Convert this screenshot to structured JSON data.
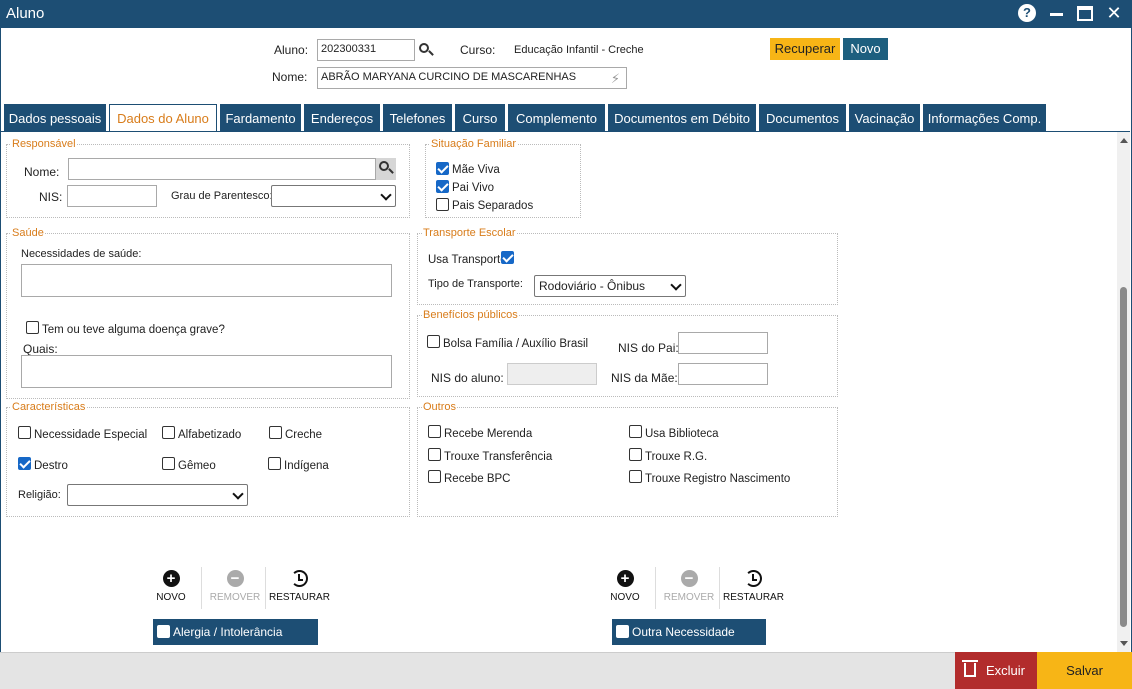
{
  "window": {
    "title": "Aluno"
  },
  "header": {
    "aluno_label": "Aluno:",
    "aluno_value": "202300331",
    "curso_label": "Curso:",
    "curso_value": "Educação Infantil - Creche",
    "nome_label": "Nome:",
    "nome_value": "ABRÃO MARYANA CURCINO DE MASCARENHAS",
    "recuperar_label": "Recuperar",
    "novo_label": "Novo"
  },
  "tabs": [
    {
      "label": "Dados pessoais"
    },
    {
      "label": "Dados do Aluno"
    },
    {
      "label": "Fardamento"
    },
    {
      "label": "Endereços"
    },
    {
      "label": "Telefones"
    },
    {
      "label": "Curso"
    },
    {
      "label": "Complemento"
    },
    {
      "label": "Documentos em Débito"
    },
    {
      "label": "Documentos"
    },
    {
      "label": "Vacinação"
    },
    {
      "label": "Informações Comp."
    }
  ],
  "responsavel": {
    "legend": "Responsável",
    "nome_label": "Nome:",
    "nome_value": "",
    "nis_label": "NIS:",
    "nis_value": "",
    "grau_label": "Grau de Parentesco:",
    "grau_value": ""
  },
  "situacao_familiar": {
    "legend": "Situação Familiar",
    "items": [
      {
        "label": "Mãe Viva",
        "checked": true
      },
      {
        "label": "Pai Vivo",
        "checked": true
      },
      {
        "label": "Pais Separados",
        "checked": false
      }
    ]
  },
  "saude": {
    "legend": "Saúde",
    "necessidades_label": "Necessidades de saúde:",
    "necessidades_value": "",
    "doenca_label": "Tem ou teve alguma doença grave?",
    "doenca_checked": false,
    "quais_label": "Quais:",
    "quais_value": ""
  },
  "transporte": {
    "legend": "Transporte Escolar",
    "usa_label": "Usa Transporte",
    "usa_checked": true,
    "tipo_label": "Tipo de Transporte:",
    "tipo_value": "Rodoviário - Ônibus"
  },
  "beneficios": {
    "legend": "Benefícios públicos",
    "bolsa_label": "Bolsa Família / Auxílio Brasil",
    "bolsa_checked": false,
    "nis_pai_label": "NIS do Pai:",
    "nis_pai_value": "",
    "nis_aluno_label": "NIS do aluno:",
    "nis_aluno_value": "",
    "nis_mae_label": "NIS da Mãe:",
    "nis_mae_value": ""
  },
  "caracteristicas": {
    "legend": "Características",
    "items": [
      {
        "label": "Necessidade Especial",
        "checked": false
      },
      {
        "label": "Alfabetizado",
        "checked": false
      },
      {
        "label": "Creche",
        "checked": false
      },
      {
        "label": "Destro",
        "checked": true
      },
      {
        "label": "Gêmeo",
        "checked": false
      },
      {
        "label": "Indígena",
        "checked": false
      }
    ],
    "religiao_label": "Religião:",
    "religiao_value": ""
  },
  "outros": {
    "legend": "Outros",
    "items": [
      {
        "label": "Recebe Merenda",
        "checked": false
      },
      {
        "label": "Usa Biblioteca",
        "checked": false
      },
      {
        "label": "Trouxe Transferência",
        "checked": false
      },
      {
        "label": "Trouxe R.G.",
        "checked": false
      },
      {
        "label": "Recebe BPC",
        "checked": false
      },
      {
        "label": "Trouxe Registro Nascimento",
        "checked": false
      }
    ]
  },
  "toolbar_left": {
    "novo": "NOVO",
    "remover": "REMOVER",
    "restaurar": "RESTAURAR",
    "list_header": "Alergia / Intolerância"
  },
  "toolbar_right": {
    "novo": "NOVO",
    "remover": "REMOVER",
    "restaurar": "RESTAURAR",
    "list_header": "Outra Necessidade"
  },
  "footer": {
    "excluir_label": "Excluir",
    "salvar_label": "Salvar"
  },
  "colors": {
    "primary": "#1d4e74",
    "accent": "#d87c1a",
    "warning": "#f7b516",
    "danger": "#b22c2c",
    "check": "#1668c7"
  }
}
